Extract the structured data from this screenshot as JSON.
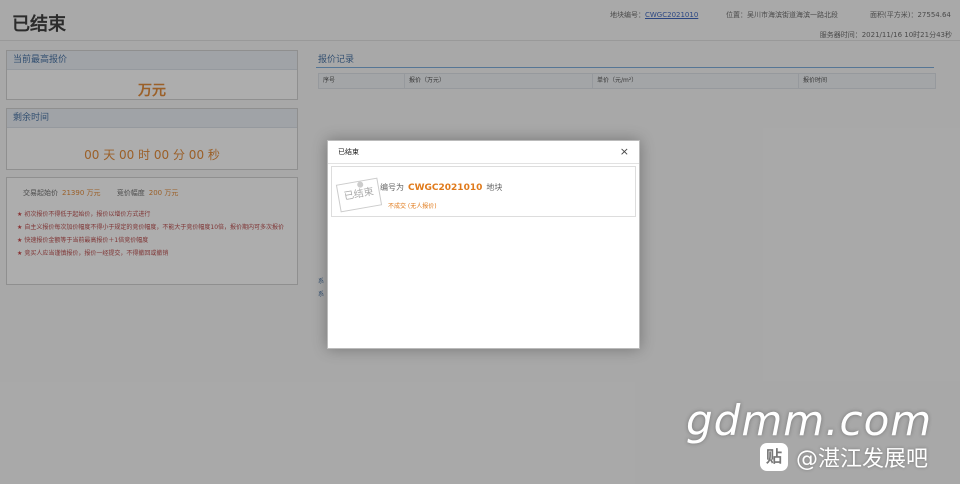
{
  "header": {
    "status_title": "已结束",
    "plot_no_label": "地块编号：",
    "plot_no_value": "CWGC2021010",
    "location_label": "位置：",
    "location_value": "吴川市海滨街道海滨一路北段",
    "area_label": "面积(平方米)：",
    "area_value": "27554.64",
    "server_time_label": "服务器时间：",
    "server_time_value": "2021/11/16  10时21分43秒"
  },
  "left": {
    "highest_bid_title": "当前最高报价",
    "highest_bid_value": "万元",
    "remaining_title": "剩余时间",
    "countdown": "00 天 00 时 00 分 00 秒",
    "start_price_label": "交易起始价",
    "start_price_value": "21390 万元",
    "increment_label": "竞价幅度",
    "increment_value": "200 万元",
    "rules": [
      "初次报价不得低于起始价，报价以增价方式进行",
      "自主义报价每次加价幅度不得小于规定的竞价幅度，不能大于竞价幅度10倍，报价期内可多次报价",
      "快速报价金额等于当前最高报价＋1倍竞价幅度",
      "竞买人应当谨慎报价，报价一经提交，不得撤回或撤销"
    ]
  },
  "bids": {
    "title": "报价记录",
    "columns": [
      "序号",
      "报价（万元）",
      "单价（元/m²）",
      "报价时间"
    ]
  },
  "dialog": {
    "title": "已结束",
    "close": "×",
    "stamp": "已结束",
    "line_prefix": "编号为",
    "code": "CWGC2021010",
    "line_suffix": "地块",
    "result": "不成交 (无人报价)"
  },
  "watermark": {
    "domain": "gdmm.com",
    "icon": "贴",
    "account": "@湛江发展吧"
  }
}
